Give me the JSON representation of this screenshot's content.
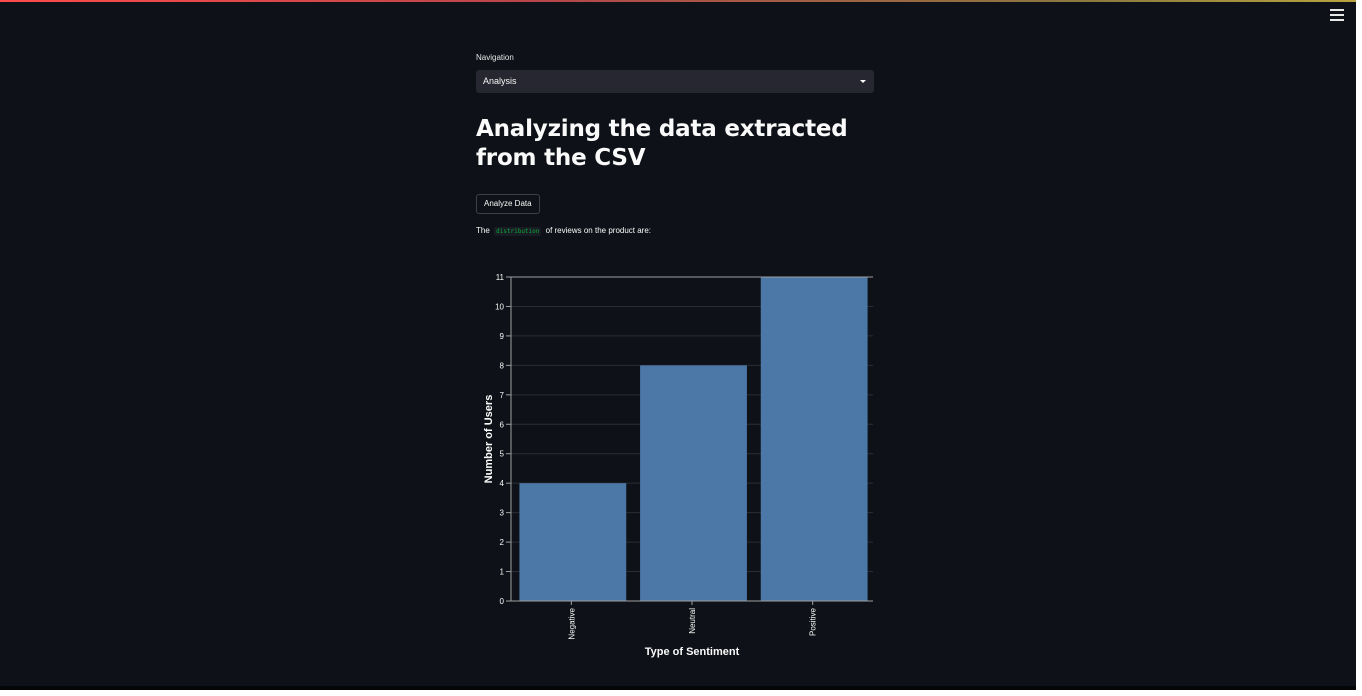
{
  "nav": {
    "label": "Navigation",
    "selected": "Analysis"
  },
  "page": {
    "title": "Analyzing the data extracted from the CSV",
    "analyze_button": "Analyze Data",
    "dist_prefix": "The",
    "dist_code": "distribution",
    "dist_suffix": "of reviews on the product are:"
  },
  "icons": {
    "menu": "hamburger-menu-icon",
    "dropdown": "chevron-down-icon"
  },
  "colors": {
    "background": "#0e1117",
    "bar": "#4c78a8",
    "code_text": "#09ab3b"
  },
  "chart_data": {
    "type": "bar",
    "categories": [
      "Negative",
      "Neutral",
      "Positive"
    ],
    "values": [
      4,
      8,
      11
    ],
    "xlabel": "Type of Sentiment",
    "ylabel": "Number of Users",
    "ylim": [
      0,
      11
    ],
    "yticks": [
      0,
      1,
      2,
      3,
      4,
      5,
      6,
      7,
      8,
      9,
      10,
      11
    ],
    "grid": true
  }
}
